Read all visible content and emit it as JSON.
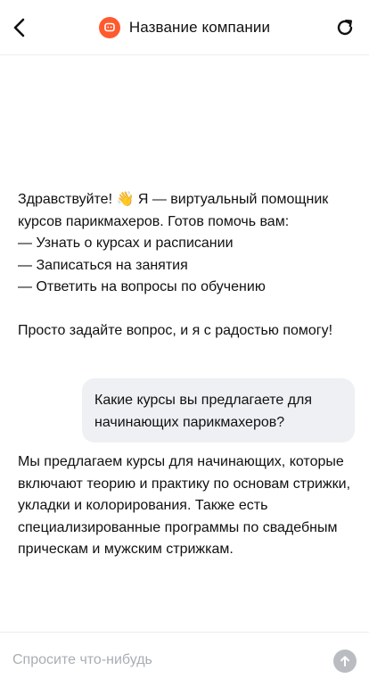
{
  "header": {
    "title": "Название компании",
    "back_icon": "chevron-left-icon",
    "refresh_icon": "refresh-icon",
    "logo_icon": "chat-logo-icon",
    "accent_color": "#ff5a2e"
  },
  "messages": [
    {
      "role": "assistant",
      "text": "Здравствуйте! 👋 Я — виртуальный помощник курсов парикмахеров. Готов помочь вам:\n— Узнать о курсах и расписании\n— Записаться на занятия\n— Ответить на вопросы по обучению\n\nПросто задайте вопрос, и я с радостью помогу!"
    },
    {
      "role": "user",
      "text": "Какие курсы вы предлагаете для начинающих парикмахеров?"
    },
    {
      "role": "assistant",
      "text": "Мы предлагаем курсы для начинающих, которые включают теорию и практику по основам стрижки, укладки и колорирования. Также есть специализированные программы по свадебным прическам и мужским стрижкам."
    }
  ],
  "input": {
    "placeholder": "Спросите что-нибудь",
    "value": "",
    "send_icon": "arrow-up-icon"
  }
}
